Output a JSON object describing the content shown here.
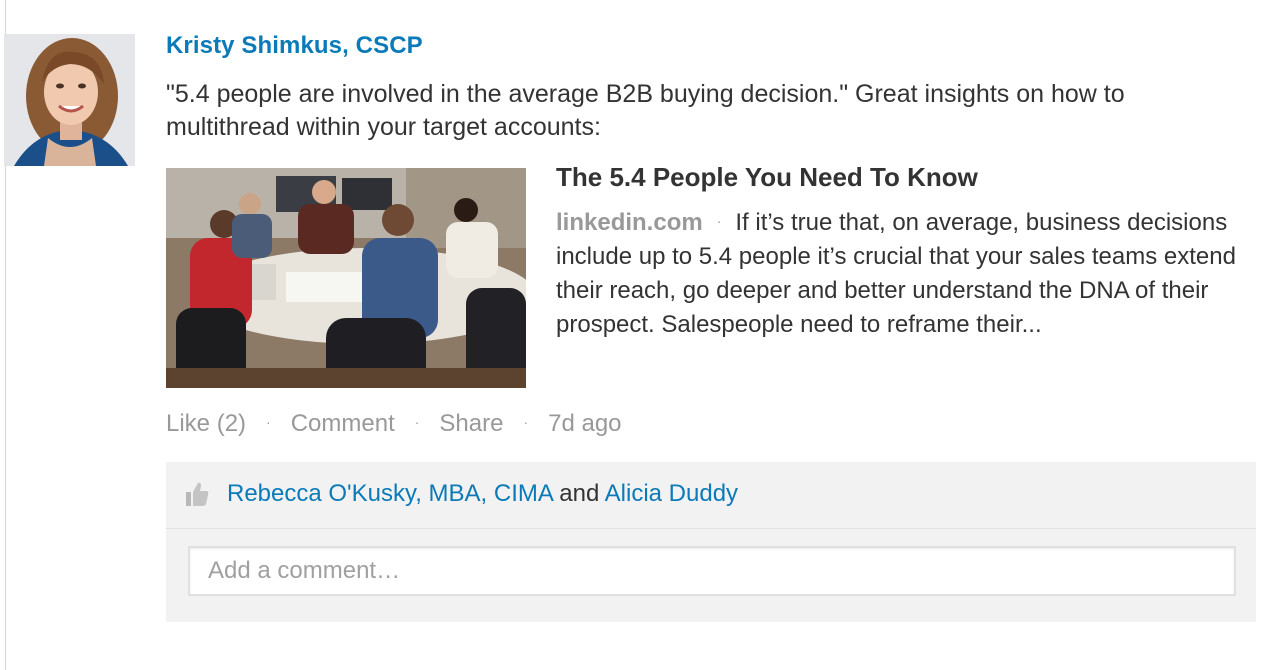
{
  "post": {
    "author_name": "Kristy Shimkus, CSCP",
    "text": "\"5.4 people are involved in the average B2B buying decision.\" Great insights on how to multithread within your target accounts:"
  },
  "article": {
    "title": "The 5.4 People You Need To Know",
    "domain": "linkedin.com",
    "separator": "·",
    "description": "If it’s true that, on average, business decisions include up to 5.4 people it’s crucial that your sales teams extend their reach, go deeper and better understand the DNA of their prospect. Salespeople need to reframe their..."
  },
  "actions": {
    "like_label": "Like (2)",
    "comment_label": "Comment",
    "share_label": "Share",
    "timestamp": "7d ago",
    "separator": "·"
  },
  "likes": {
    "liker_1": "Rebecca O'Kusky, MBA, CIMA",
    "conjunction": "and",
    "liker_2": "Alicia Duddy",
    "icon": "thumbs-up-icon"
  },
  "comment": {
    "placeholder": "Add a comment…"
  },
  "colors": {
    "link_blue": "#0b7ab8",
    "text_dark": "#333333",
    "text_muted": "#999999",
    "panel_gray": "#f2f2f2"
  }
}
